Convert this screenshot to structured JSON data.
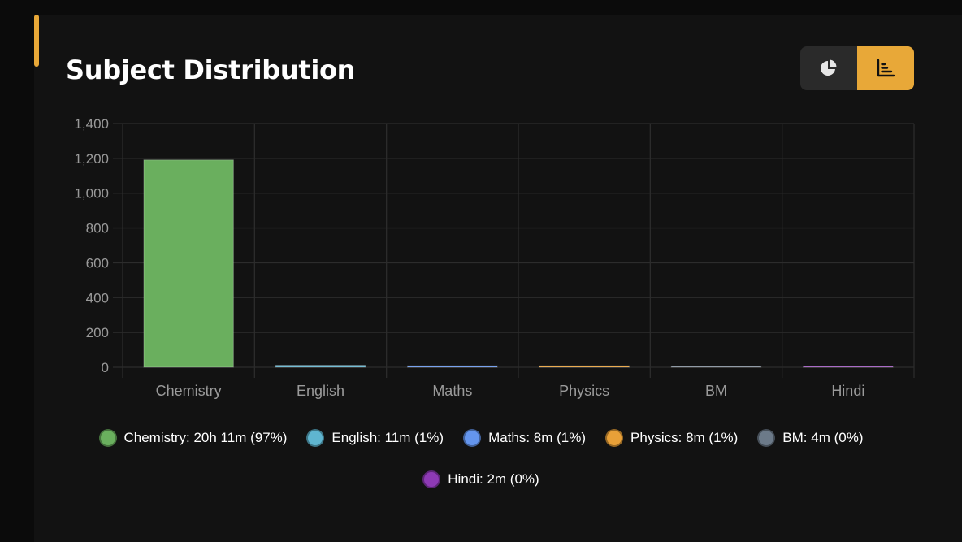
{
  "header": {
    "title": "Subject Distribution"
  },
  "toggle": {
    "pie_icon": "pie-chart-icon",
    "bar_icon": "bar-chart-icon",
    "active": "bar"
  },
  "colors": {
    "accent": "#e8a838",
    "grid": "#2c2c2c",
    "tick_text": "#9a9a9a"
  },
  "chart_data": {
    "type": "bar",
    "categories": [
      "Chemistry",
      "English",
      "Maths",
      "Physics",
      "BM",
      "Hindi"
    ],
    "values": [
      1191,
      11,
      8,
      8,
      4,
      2
    ],
    "colors": [
      "#6aaf5e",
      "#5fb5d0",
      "#6495ed",
      "#e8a038",
      "#6c7a89",
      "#8e3ab5"
    ],
    "ylim": [
      0,
      1400
    ],
    "yticks": [
      0,
      200,
      400,
      600,
      800,
      1000,
      1200,
      1400
    ],
    "ytick_labels": [
      "0",
      "200",
      "400",
      "600",
      "800",
      "1,000",
      "1,200",
      "1,400"
    ],
    "grid": true,
    "legend_position": "bottom",
    "legend": [
      "Chemistry: 20h 11m (97%)",
      "English: 11m (1%)",
      "Maths: 8m (1%)",
      "Physics: 8m (1%)",
      "BM: 4m (0%)",
      "Hindi: 2m (0%)"
    ]
  }
}
